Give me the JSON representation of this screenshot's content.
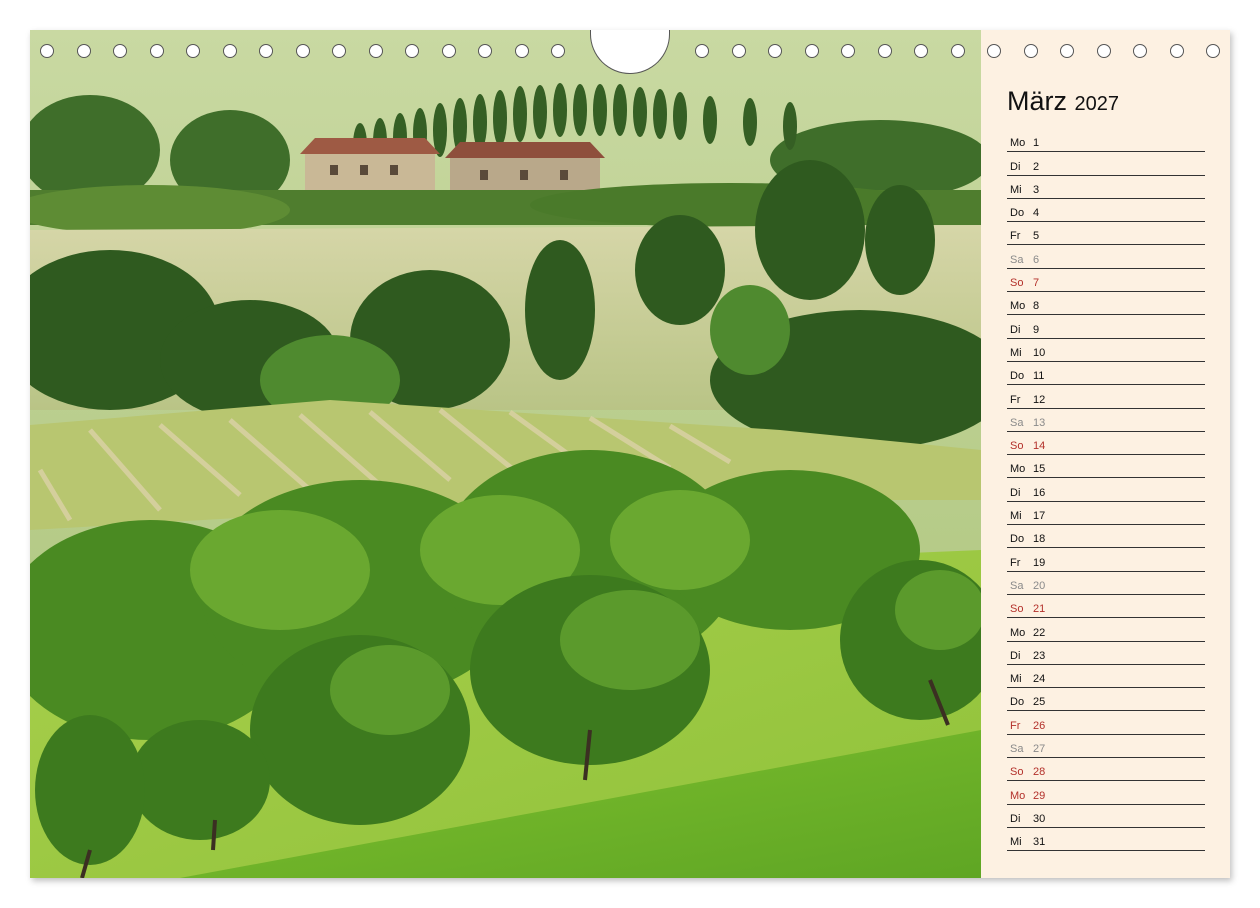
{
  "calendar": {
    "month": "März",
    "year": "2027",
    "days": [
      {
        "wd": "Mo",
        "d": "1",
        "type": "normal"
      },
      {
        "wd": "Di",
        "d": "2",
        "type": "normal"
      },
      {
        "wd": "Mi",
        "d": "3",
        "type": "normal"
      },
      {
        "wd": "Do",
        "d": "4",
        "type": "normal"
      },
      {
        "wd": "Fr",
        "d": "5",
        "type": "normal"
      },
      {
        "wd": "Sa",
        "d": "6",
        "type": "sat"
      },
      {
        "wd": "So",
        "d": "7",
        "type": "red"
      },
      {
        "wd": "Mo",
        "d": "8",
        "type": "normal"
      },
      {
        "wd": "Di",
        "d": "9",
        "type": "normal"
      },
      {
        "wd": "Mi",
        "d": "10",
        "type": "normal"
      },
      {
        "wd": "Do",
        "d": "11",
        "type": "normal"
      },
      {
        "wd": "Fr",
        "d": "12",
        "type": "normal"
      },
      {
        "wd": "Sa",
        "d": "13",
        "type": "sat"
      },
      {
        "wd": "So",
        "d": "14",
        "type": "red"
      },
      {
        "wd": "Mo",
        "d": "15",
        "type": "normal"
      },
      {
        "wd": "Di",
        "d": "16",
        "type": "normal"
      },
      {
        "wd": "Mi",
        "d": "17",
        "type": "normal"
      },
      {
        "wd": "Do",
        "d": "18",
        "type": "normal"
      },
      {
        "wd": "Fr",
        "d": "19",
        "type": "normal"
      },
      {
        "wd": "Sa",
        "d": "20",
        "type": "sat"
      },
      {
        "wd": "So",
        "d": "21",
        "type": "red"
      },
      {
        "wd": "Mo",
        "d": "22",
        "type": "normal"
      },
      {
        "wd": "Di",
        "d": "23",
        "type": "normal"
      },
      {
        "wd": "Mi",
        "d": "24",
        "type": "normal"
      },
      {
        "wd": "Do",
        "d": "25",
        "type": "normal"
      },
      {
        "wd": "Fr",
        "d": "26",
        "type": "red"
      },
      {
        "wd": "Sa",
        "d": "27",
        "type": "sat"
      },
      {
        "wd": "So",
        "d": "28",
        "type": "red"
      },
      {
        "wd": "Mo",
        "d": "29",
        "type": "red"
      },
      {
        "wd": "Di",
        "d": "30",
        "type": "normal"
      },
      {
        "wd": "Mi",
        "d": "31",
        "type": "normal"
      }
    ]
  },
  "colors": {
    "sidebar_bg": "#fdf1e2",
    "weekday_text": "#111111",
    "saturday_text": "#8a8a8a",
    "holiday_text": "#b3302a"
  }
}
